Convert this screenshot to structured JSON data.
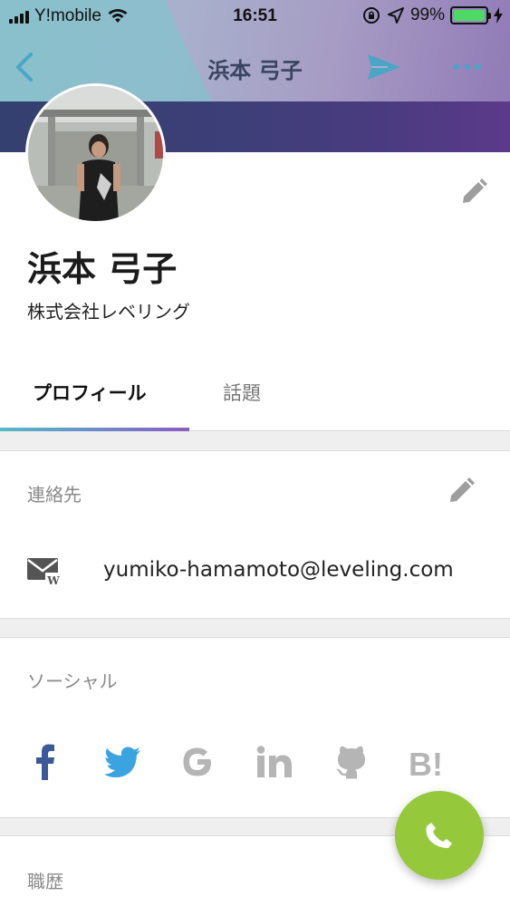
{
  "status_bar": {
    "carrier": "Y!mobile",
    "time": "16:51",
    "battery_percent": "99%",
    "battery_level": 0.99,
    "battery_color": "#4cd964"
  },
  "nav": {
    "back_icon": "chevron-left-icon",
    "title": "浜本 弓子",
    "send_icon": "paper-plane-icon",
    "more_icon": "more-dots-icon"
  },
  "profile": {
    "name": "浜本 弓子",
    "company": "株式会社レベリング",
    "edit_icon": "pencil-icon"
  },
  "tabs": [
    {
      "label": "プロフィール",
      "active": true
    },
    {
      "label": "話題",
      "active": false
    }
  ],
  "contact": {
    "title": "連絡先",
    "edit_icon": "pencil-icon",
    "email_icon": "mail-icon",
    "email": "yumiko-hamamoto@leveling.com"
  },
  "social": {
    "title": "ソーシャル",
    "items": [
      {
        "icon": "facebook-icon",
        "color": "#3b5998"
      },
      {
        "icon": "twitter-icon",
        "color": "#3aa3e0"
      },
      {
        "icon": "google-icon",
        "color": "#b5b5b5"
      },
      {
        "icon": "linkedin-icon",
        "color": "#b5b5b5"
      },
      {
        "icon": "github-icon",
        "color": "#b5b5b5"
      },
      {
        "icon": "hatena-bookmark-icon",
        "color": "#b5b5b5"
      }
    ]
  },
  "career": {
    "title": "職歴"
  },
  "fab": {
    "icon": "phone-icon",
    "color": "#96c83c"
  }
}
